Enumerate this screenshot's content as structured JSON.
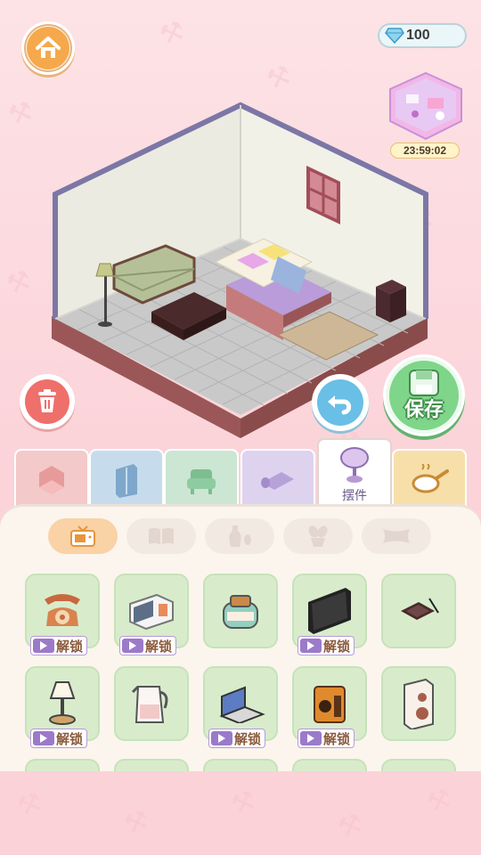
{
  "header": {
    "gems": "100",
    "promo_timer": "23:59:02"
  },
  "room": {
    "floor": "gray-tile",
    "items": [
      "sofa-green",
      "floor-lamp",
      "coffee-table",
      "bed",
      "rug",
      "nightstand",
      "window"
    ]
  },
  "actions": {
    "save_label": "保存"
  },
  "categories": [
    {
      "icon": "room-shape-icon",
      "color": "#f4c9c9"
    },
    {
      "icon": "wardrobe-icon",
      "color": "#c6dcec"
    },
    {
      "icon": "armchair-icon",
      "color": "#cbe6d2"
    },
    {
      "icon": "rug-icon",
      "color": "#ddd3ef"
    },
    {
      "icon": "table-lamp-icon",
      "label": "摆件",
      "active": true
    },
    {
      "icon": "frying-pan-icon",
      "color": "#f7dfa9"
    }
  ],
  "subtabs": [
    "tv-icon",
    "book-icon",
    "vase-icon",
    "plant-icon",
    "pillow-icon"
  ],
  "items": [
    {
      "name": "telephone",
      "locked": true,
      "unlock_label": "解锁"
    },
    {
      "name": "microwave",
      "locked": true,
      "unlock_label": "解锁"
    },
    {
      "name": "toaster",
      "locked": false
    },
    {
      "name": "television",
      "locked": true,
      "unlock_label": "解锁"
    },
    {
      "name": "tablet",
      "locked": false
    },
    {
      "name": "table-lamp",
      "locked": true,
      "unlock_label": "解锁"
    },
    {
      "name": "kettle",
      "locked": false
    },
    {
      "name": "laptop",
      "locked": true,
      "unlock_label": "解锁"
    },
    {
      "name": "radio",
      "locked": true,
      "unlock_label": "解锁"
    },
    {
      "name": "speaker",
      "locked": false
    }
  ],
  "colors": {
    "accent": "#f5a94c",
    "save": "#7fd58a",
    "panel": "#fbf5ee"
  }
}
